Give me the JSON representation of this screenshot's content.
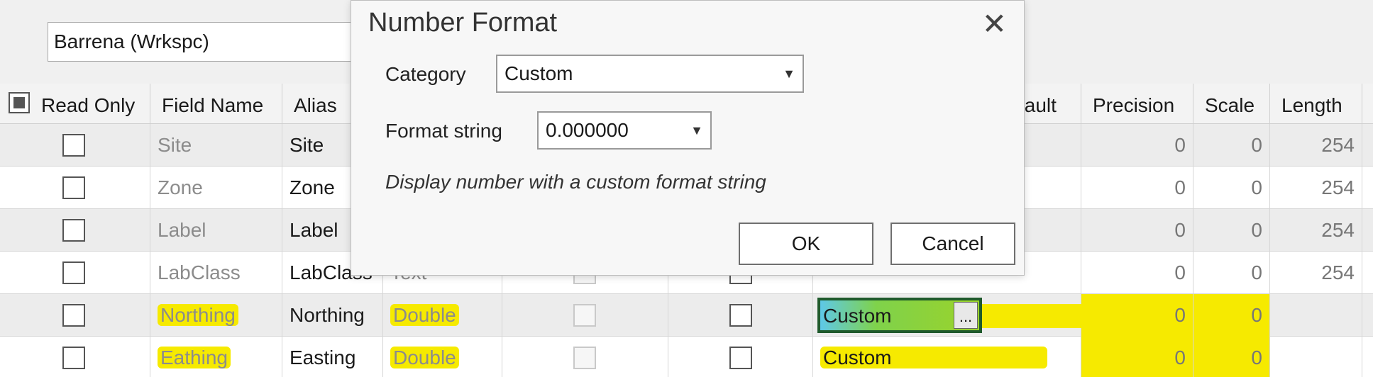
{
  "workspace_combo": "Barrena (Wrkspc)",
  "columns": {
    "read_only": "Read Only",
    "field_name": "Field Name",
    "alias": "Alias",
    "default_partial": "fault",
    "precision": "Precision",
    "scale": "Scale",
    "length": "Length"
  },
  "rows": [
    {
      "field": "Site",
      "alias": "Site",
      "type": "",
      "number_format": "",
      "precision": "0",
      "scale": "0",
      "length": "254"
    },
    {
      "field": "Zone",
      "alias": "Zone",
      "type": "",
      "number_format": "",
      "precision": "0",
      "scale": "0",
      "length": "254"
    },
    {
      "field": "Label",
      "alias": "Label",
      "type": "",
      "number_format": "",
      "precision": "0",
      "scale": "0",
      "length": "254"
    },
    {
      "field": "LabClass",
      "alias": "LabClass",
      "type": "Text",
      "number_format": "",
      "precision": "0",
      "scale": "0",
      "length": "254"
    },
    {
      "field": "Northing",
      "alias": "Northing",
      "type": "Double",
      "number_format": "Custom",
      "precision": "0",
      "scale": "0",
      "length": ""
    },
    {
      "field": "Eathing",
      "alias": "Easting",
      "type": "Double",
      "number_format": "Custom",
      "precision": "0",
      "scale": "0",
      "length": ""
    }
  ],
  "edit_ellipsis": "...",
  "dialog": {
    "title": "Number Format",
    "close_glyph": "✕",
    "category_label": "Category",
    "category_value": "Custom",
    "format_label": "Format string",
    "format_value": "0.000000",
    "description": "Display number with a custom format string",
    "ok": "OK",
    "cancel": "Cancel"
  },
  "icons": {
    "dropdown": "chevron-down-icon",
    "close": "close-icon"
  },
  "colors": {
    "highlight": "#f6ea00",
    "edit_border": "#1f5a2c"
  }
}
